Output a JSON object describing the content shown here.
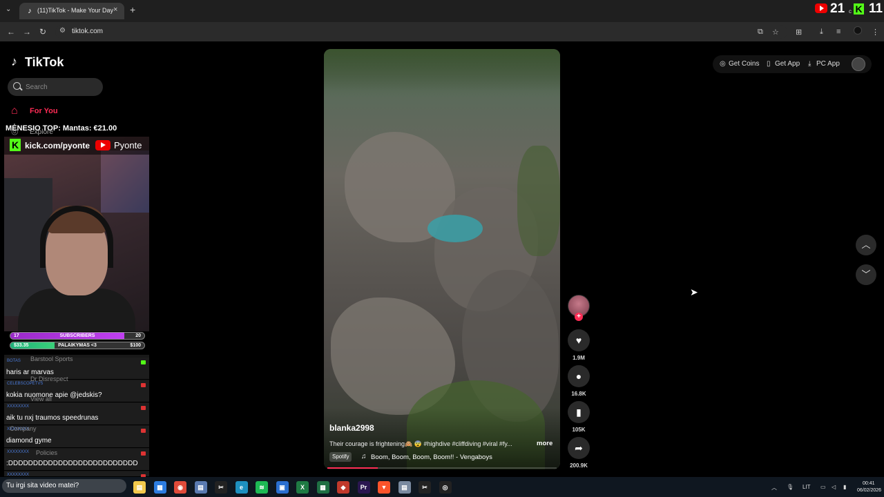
{
  "browser": {
    "tab_title": "(11)TikTok - Make Your Day",
    "url": "tiktok.com",
    "new_tab_label": "+",
    "close_label": "×"
  },
  "stream_overlay": {
    "youtube_count": "21",
    "kick_count": "11",
    "kick_letter": "K",
    "separator": "c",
    "top_donor": "MĖNESIO TOP:   Mantas: €21.00",
    "kick_url": "kick.com/pyonte",
    "youtube_name": "Pyonte",
    "goals": [
      {
        "left": "17",
        "center": "SUBSCRIBERS",
        "right": "20",
        "progress": 0.85
      },
      {
        "left": "$33.35",
        "center": "PALAIKYMAS <3",
        "right": "$100",
        "progress": 0.33
      }
    ],
    "chat": [
      {
        "user": "BOTAS",
        "message": "haris ar marvas"
      },
      {
        "user": "CELEBSCOPETVS",
        "message": "kokia nuomone apie @jedskis?"
      },
      {
        "user": "XXXXXXXX",
        "message": "aik tu nxj traumos speedrunas"
      },
      {
        "user": "XXXXXXXX",
        "message": "diamond gyme"
      },
      {
        "user": "XXXXXXXX",
        "message": ":DDDDDDDDDDDDDDDDDDDDDDDDDD"
      },
      {
        "user": "XXXXXXXX",
        "message": ""
      }
    ],
    "chat_input": "Tu irgi sita video matei?"
  },
  "tiktok": {
    "logo": "TikTok",
    "search_placeholder": "Search",
    "nav": {
      "for_you": "For You",
      "explore": "Explore"
    },
    "ghost_items": [
      "Barstool Sports",
      "Dr Disrespect",
      "View all",
      "Company",
      "Policies"
    ],
    "header": {
      "get_coins": "Get Coins",
      "get_app": "Get App",
      "pc_app": "PC App"
    },
    "video": {
      "author": "blanka2998",
      "caption": "Their courage is frightening🙈 😨 #highdive #cliffdiving #viral #fy...",
      "more": "more",
      "music_source": "Spotify",
      "music": "Boom, Boom, Boom, Boom!! - Vengaboys",
      "progress": 0.22
    },
    "actions": {
      "likes": "1.9M",
      "comments": "16.8K",
      "saves": "105K",
      "shares": "200.9K"
    }
  },
  "taskbar": {
    "language": "LIT",
    "time": "00:41",
    "date": "06/02/2026",
    "apps": [
      "explorer",
      "store",
      "chrome",
      "notepad",
      "capcut",
      "edge",
      "spotify",
      "photos",
      "excel",
      "sheets",
      "pdf",
      "premiere",
      "brave",
      "notepad-2",
      "capcut-2",
      "obs"
    ]
  },
  "colors": {
    "accent": "#fe2c55",
    "kick_green": "#53fc18",
    "youtube_red": "#ee0000"
  }
}
